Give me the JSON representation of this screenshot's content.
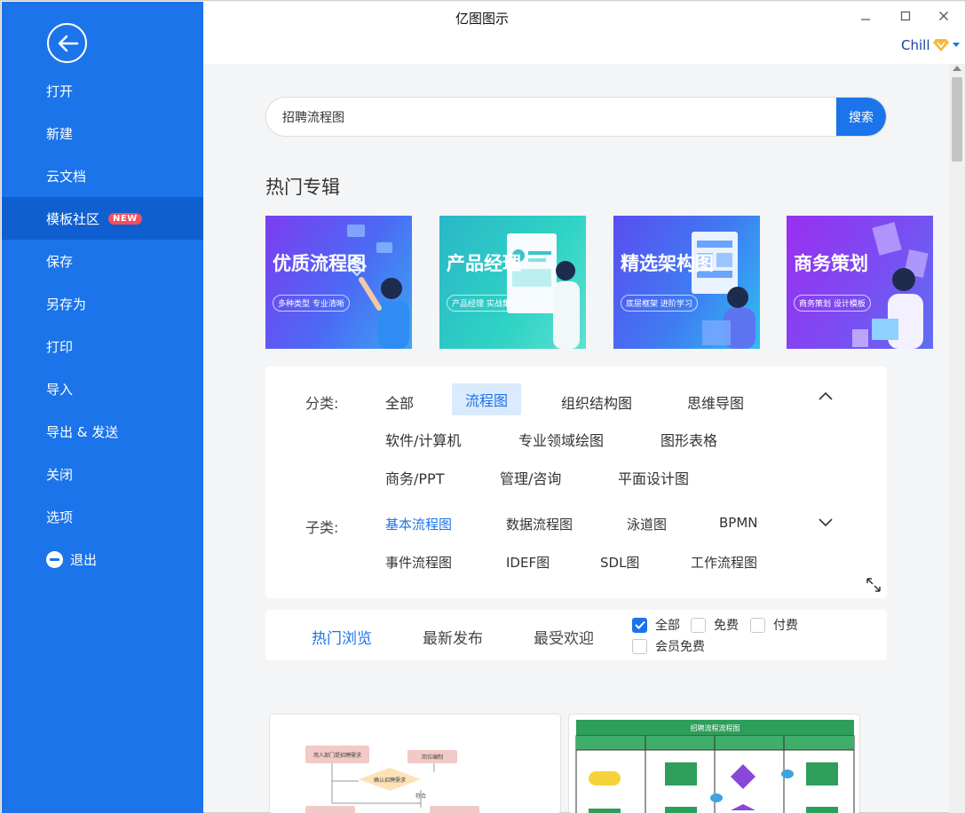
{
  "app": {
    "title": "亿图图示",
    "user_name": "Chill"
  },
  "sidebar": {
    "items": [
      {
        "label": "打开"
      },
      {
        "label": "新建"
      },
      {
        "label": "云文档"
      },
      {
        "label": "模板社区",
        "badge": "NEW"
      },
      {
        "label": "保存"
      },
      {
        "label": "另存为"
      },
      {
        "label": "打印"
      },
      {
        "label": "导入"
      },
      {
        "label": "导出 & 发送"
      },
      {
        "label": "关闭"
      },
      {
        "label": "选项"
      },
      {
        "label": "退出"
      }
    ]
  },
  "search": {
    "value": "招聘流程图",
    "button_label": "搜索"
  },
  "section_title": "热门专辑",
  "banners": [
    {
      "title": "优质流程图",
      "subtitle": "多种类型 专业清晰"
    },
    {
      "title": "产品经理",
      "subtitle": "产品经理 实战集合"
    },
    {
      "title": "精选架构图",
      "subtitle": "底层框架 进阶学习"
    },
    {
      "title": "商务策划",
      "subtitle": "商务策划 设计模板"
    }
  ],
  "filters": {
    "category_label": "分类:",
    "categories": [
      "全部",
      "流程图",
      "组织结构图",
      "思维导图",
      "软件/计算机",
      "专业领域绘图",
      "图形表格",
      "商务/PPT",
      "管理/咨询",
      "平面设计图"
    ],
    "subcategory_label": "子类:",
    "subcategories": [
      "基本流程图",
      "数据流程图",
      "泳道图",
      "BPMN",
      "事件流程图",
      "IDEF图",
      "SDL图",
      "工作流程图"
    ]
  },
  "sort_tabs": [
    "热门浏览",
    "最新发布",
    "最受欢迎"
  ],
  "price_filters": [
    {
      "label": "全部",
      "checked": true
    },
    {
      "label": "免费",
      "checked": false
    },
    {
      "label": "付费",
      "checked": false
    },
    {
      "label": "会员免费",
      "checked": false
    }
  ],
  "cards": [
    {
      "nodes": [
        "用人部门提招聘需求",
        "岗位编制",
        "确认招聘需求",
        "符合"
      ]
    },
    {
      "title": "招聘流程流程图"
    }
  ],
  "colors": {
    "sidebar_bg": "#1b74e9",
    "accent": "#1b74e9",
    "badge": "#f34f5f"
  }
}
